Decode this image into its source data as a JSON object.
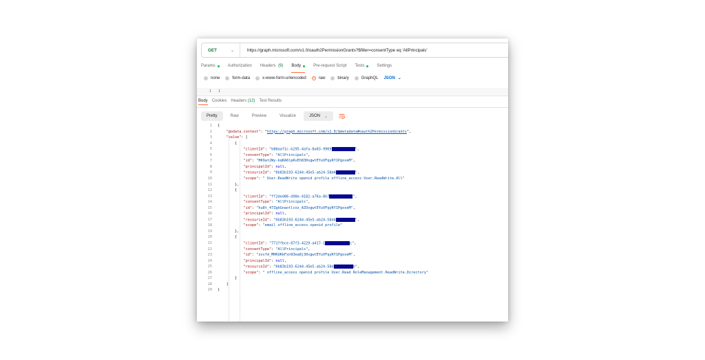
{
  "request": {
    "method": "GET",
    "url": "https://graph.microsoft.com/v1.0/oauth2PermissionGrants?$filter=consentType eq 'AllPrincipals'"
  },
  "request_tabs": [
    {
      "label": "Params",
      "dot": true
    },
    {
      "label": "Authorization"
    },
    {
      "label": "Headers",
      "count": "(9)"
    },
    {
      "label": "Body",
      "dot": true,
      "active": true
    },
    {
      "label": "Pre-request Script"
    },
    {
      "label": "Tests",
      "dot": true
    },
    {
      "label": "Settings"
    }
  ],
  "body_types": [
    "none",
    "form-data",
    "x-www-form-urlencoded",
    "raw",
    "binary",
    "GraphQL"
  ],
  "body_type_selected": "raw",
  "body_format": "JSON",
  "request_editor": {
    "line": "1",
    "content": "1"
  },
  "response_tabs": [
    {
      "label": "Body",
      "active": true
    },
    {
      "label": "Cookies"
    },
    {
      "label": "Headers",
      "count": "(12)"
    },
    {
      "label": "Test Results"
    }
  ],
  "view_modes": [
    "Pretty",
    "Raw",
    "Preview",
    "Visualize"
  ],
  "view_format": "JSON",
  "colors": {
    "accent": "#ff6c37",
    "method": "#0c7a3d",
    "redaction": "#050a8f"
  },
  "response_lines": [
    [
      "1",
      "{"
    ],
    [
      "2",
      "    \"@odata.context\": \"https://graph.microsoft.com/v1.0/$metadata#oauth2PermissionGrants\","
    ],
    [
      "3",
      "    \"value\": ["
    ],
    [
      "4",
      "        {"
    ],
    [
      "5",
      "            \"clientId\": \"b88aaf1c-b295-4afa-8a03-9969",
      "\","
    ],
    [
      "6",
      "            \"consentType\": \"AllPrincipals\","
    ],
    [
      "7",
      "            \"id\": \"HK9at2Wy-kqKA6lpRvEh830xgwtEYuVFqyRY1PgoxeM\","
    ],
    [
      "8",
      "            \"principalId\": null,"
    ],
    [
      "9",
      "            \"resourceId\": \"0b83b193-6244-45e5-ab24-58d4",
      "\","
    ],
    [
      "10",
      "            \"scope\": \" User.ReadWrite openid profile offline_access User.ReadWrite.All\""
    ],
    [
      "11",
      "        },"
    ],
    [
      "12",
      "        {"
    ],
    [
      "13",
      "            \"clientId\": \"ff2ded86-d98e-4182-a76a-8b7",
      "\","
    ],
    [
      "14",
      "            \"consentType\": \"AllPrincipals\","
    ],
    [
      "15",
      "            \"id\": \"hu8t_47ZgkGnaotlcoz_AZOxgwtEYuVFqyRY1PgoxeM\","
    ],
    [
      "16",
      "            \"principalId\": null,"
    ],
    [
      "17",
      "            \"resourceId\": \"0b83b193-6244-45e5-ab24-58d4",
      "\","
    ],
    [
      "18",
      "            \"scope\": \"email offline_access openid profile\""
    ],
    [
      "19",
      "        },"
    ],
    [
      "20",
      "        {"
    ],
    [
      "21",
      "            \"clientId\": \"771ffbce-07f3-4229-a417-1",
      "c\","
    ],
    [
      "22",
      "            \"consentType\": \"AllPrincipals\","
    ],
    [
      "23",
      "            \"id\": \"zvsfd_MHKUKkFxn93ea8j30xgwtEYuVFqyRY1PgoxeM\","
    ],
    [
      "24",
      "            \"principalId\": null,"
    ],
    [
      "25",
      "            \"resourceId\": \"0b83b193-6244-45e5-ab24-58d",
      "b\","
    ],
    [
      "26",
      "            \"scope\": \" offline_access openid profile User.Read RoleManagement.ReadWrite.Directory\""
    ],
    [
      "27",
      "        }"
    ],
    [
      "28",
      "    ]"
    ],
    [
      "29",
      "}"
    ]
  ]
}
